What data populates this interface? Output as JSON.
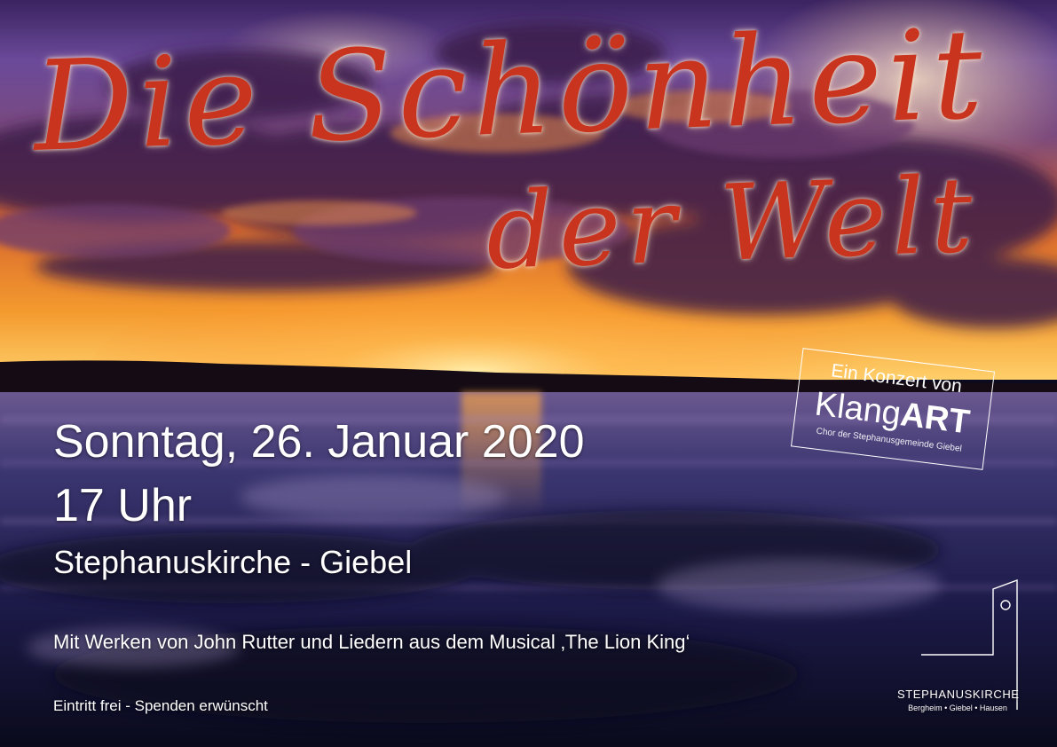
{
  "title": {
    "line1": "Die Schönheit",
    "line2": "der Welt"
  },
  "event": {
    "date": "Sonntag, 26. Januar 2020",
    "time": "17 Uhr",
    "venue": "Stephanuskirche - Giebel",
    "program": "Mit Werken von John Rutter und Liedern aus dem Musical ‚The Lion King‘",
    "admission": "Eintritt frei - Spenden erwünscht"
  },
  "performer": {
    "intro": "Ein Konzert von",
    "name_part1": "Klang",
    "name_part2": "ART",
    "subtitle": "Chor der Stephanusgemeinde Giebel"
  },
  "church": {
    "name": "STEPHANUSKIRCHE",
    "places": "Bergheim • Giebel • Hausen"
  },
  "colors": {
    "title": "#c8341e",
    "text": "#ffffff"
  },
  "icons": {
    "church_logo": "church-tower-outline-icon"
  }
}
